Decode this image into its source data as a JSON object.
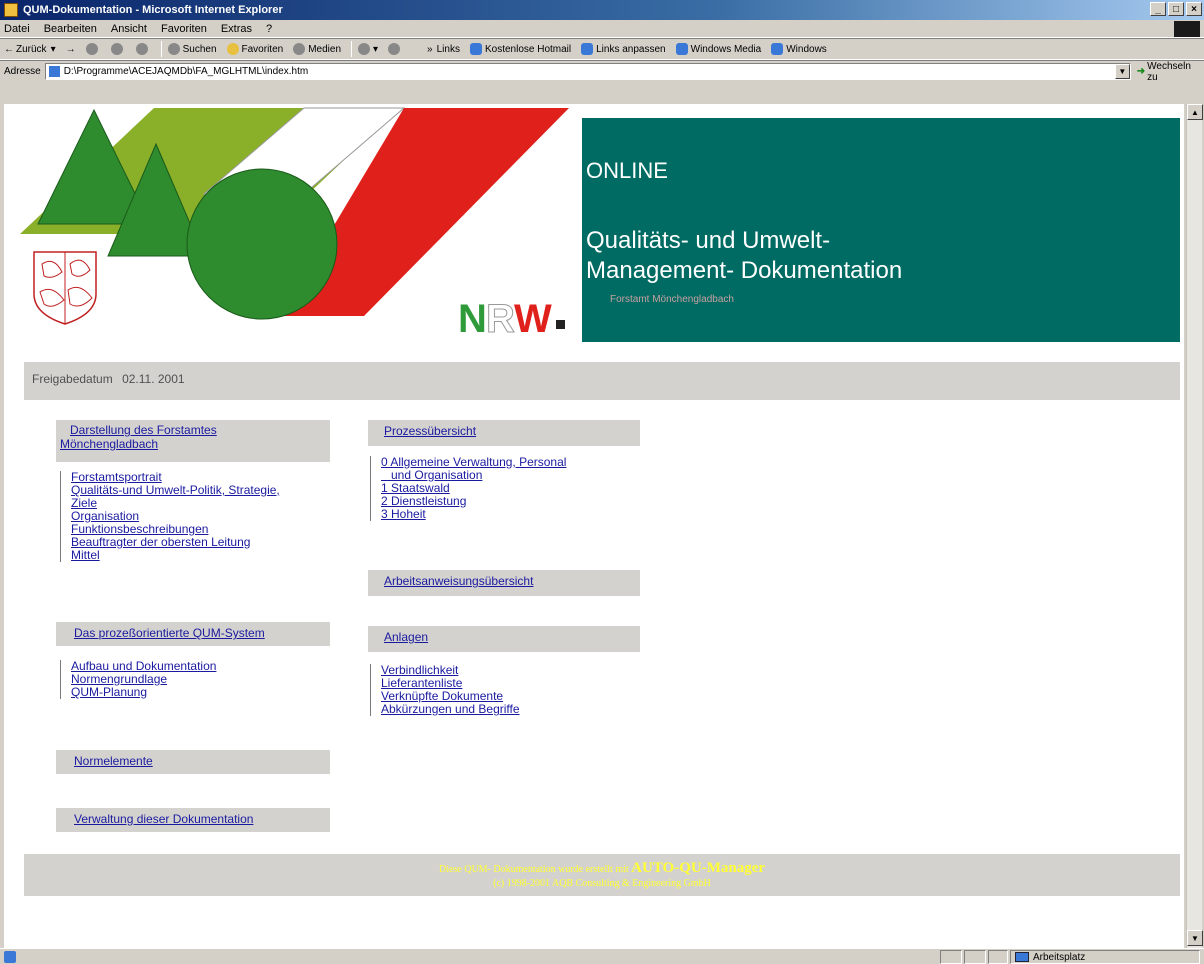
{
  "window": {
    "title": "QUM-Dokumentation - Microsoft Internet Explorer",
    "buttons": {
      "minimize": "_",
      "maximize": "□",
      "close": "×"
    }
  },
  "menu": [
    "Datei",
    "Bearbeiten",
    "Ansicht",
    "Favoriten",
    "Extras",
    "?"
  ],
  "toolbar": {
    "back": "Zurück",
    "search": "Suchen",
    "favorites": "Favoriten",
    "media": "Medien",
    "links_label": "Links",
    "links": [
      "Kostenlose Hotmail",
      "Links anpassen",
      "Windows Media",
      "Windows"
    ]
  },
  "address": {
    "label": "Adresse",
    "value": "D:\\Programme\\ACEJAQMDb\\FA_MGLHTML\\index.htm",
    "go": "Wechseln zu"
  },
  "banner": {
    "online": "ONLINE",
    "title": "Qualitäts- und     Umwelt-\nManagement- Dokumentation",
    "subtitle": "Forstamt Mönchengladbach",
    "nrw_logo": "NRW."
  },
  "release": {
    "label": "Freigabedatum",
    "date": "02.11. 2001"
  },
  "left_column": {
    "section1": {
      "heading_line1": "Darstellung des Forstamtes",
      "heading_line2": "Mönchengladbach",
      "links": [
        "Forstamtsportrait",
        "Qualitäts-und Umwelt-Politik, Strategie,",
        "Ziele",
        "Organisation",
        "Funktionsbeschreibungen",
        "Beauftragter der obersten Leitung",
        "Mittel"
      ]
    },
    "section2": {
      "heading": "Das prozeßorientierte QUM-System",
      "links": [
        "Aufbau und Dokumentation",
        "Normengrundlage",
        "QUM-Planung"
      ]
    },
    "section3": {
      "heading": "Normelemente"
    },
    "section4": {
      "heading": "Verwaltung dieser Dokumentation"
    }
  },
  "right_column": {
    "section1": {
      "heading": "Prozessübersicht",
      "links": [
        "0 Allgemeine Verwaltung, Personal",
        "   und Organisation",
        "1 Staatswald",
        "2 Dienstleistung",
        "3 Hoheit"
      ]
    },
    "section2": {
      "heading": "Arbeitsanweisungsübersicht"
    },
    "section3": {
      "heading": "Anlagen",
      "links": [
        "Verbindlichkeit",
        "Lieferantenliste",
        "Verknüpfte Dokumente",
        "Abkürzungen und Begriffe"
      ]
    }
  },
  "footer": {
    "line1_prefix": "Diese QUM- Dokumentation wurde erstellt mit",
    "brand": "AUTO-QU-Manager",
    "line2": "(c) 1998-2001 AQB Consulting & Engineering GmbH"
  },
  "statusbar": {
    "zone": "Arbeitsplatz"
  },
  "colors": {
    "banner_green": "#006b63",
    "link": "#1a1aa0",
    "section_bg": "#d4d2cf",
    "footer_text": "#ffff33",
    "tree_green": "#2e8b2e",
    "olive": "#8ab02a",
    "red": "#e0201a"
  }
}
